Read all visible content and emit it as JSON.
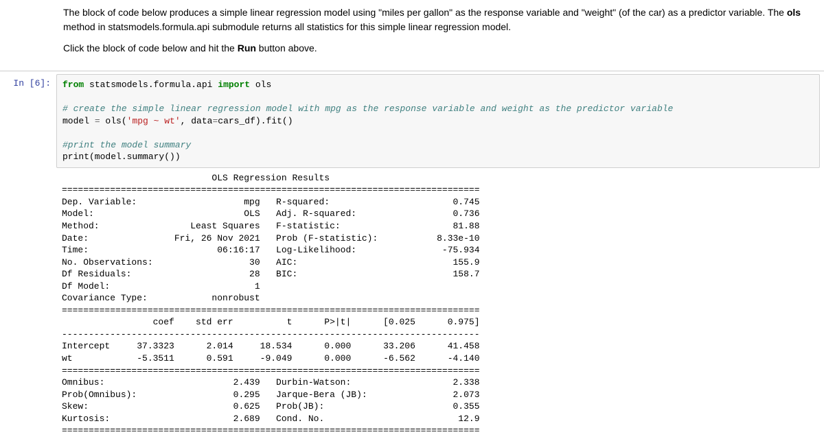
{
  "markdown": {
    "p1_prefix": "The block of code below produces a simple linear regression model using \"miles per gallon\" as the response variable and \"weight\" (of the car) as a predictor variable. The ",
    "p1_bold1": "ols",
    "p1_suffix": " method in statsmodels.formula.api submodule returns all statistics for this simple linear regression model.",
    "p2_prefix": "Click the block of code below and hit the ",
    "p2_bold": "Run",
    "p2_suffix": " button above."
  },
  "prompt": "In [6]:",
  "code": {
    "l1_kw1": "from",
    "l1_mid": " statsmodels.formula.api ",
    "l1_kw2": "import",
    "l1_end": " ols",
    "blank": "",
    "l2_comment": "# create the simple linear regression model with mpg as the response variable and weight as the predictor variable",
    "l3_a": "model ",
    "l3_op": "=",
    "l3_b": " ols(",
    "l3_str": "'mpg ~ wt'",
    "l3_c": ", data",
    "l3_op2": "=",
    "l3_d": "cars_df).fit()",
    "l4_comment": "#print the model summary",
    "l5": "print(model.summary())"
  },
  "output": "                            OLS Regression Results                            \n==============================================================================\nDep. Variable:                    mpg   R-squared:                       0.745\nModel:                            OLS   Adj. R-squared:                  0.736\nMethod:                 Least Squares   F-statistic:                     81.88\nDate:                Fri, 26 Nov 2021   Prob (F-statistic):           8.33e-10\nTime:                        06:16:17   Log-Likelihood:                -75.934\nNo. Observations:                  30   AIC:                             155.9\nDf Residuals:                      28   BIC:                             158.7\nDf Model:                           1                                         \nCovariance Type:            nonrobust                                         \n==============================================================================\n                 coef    std err          t      P>|t|      [0.025      0.975]\n------------------------------------------------------------------------------\nIntercept     37.3323      2.014     18.534      0.000      33.206      41.458\nwt            -5.3511      0.591     -9.049      0.000      -6.562      -4.140\n==============================================================================\nOmnibus:                        2.439   Durbin-Watson:                   2.338\nProb(Omnibus):                  0.295   Jarque-Bera (JB):                2.073\nSkew:                           0.625   Prob(JB):                        0.355\nKurtosis:                       2.689   Cond. No.                         12.9\n=============================================================================="
}
